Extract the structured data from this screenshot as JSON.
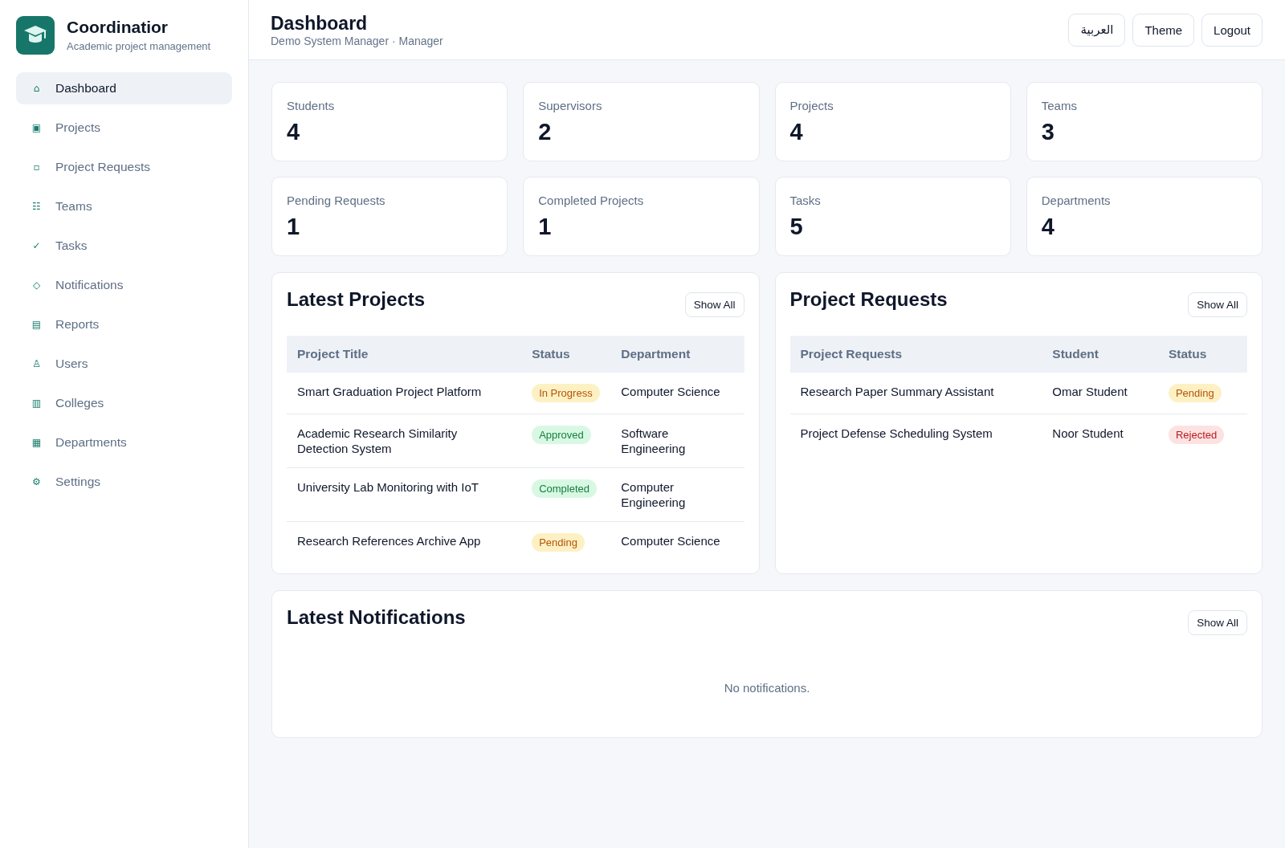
{
  "sidebar": {
    "brand": {
      "title": "Coordinatior",
      "subtitle": "Academic project management"
    },
    "items": [
      {
        "icon": "⌂",
        "label": "Dashboard",
        "selected": true
      },
      {
        "icon": "▣",
        "label": "Projects",
        "selected": false
      },
      {
        "icon": "▫",
        "label": "Project Requests",
        "selected": false
      },
      {
        "icon": "☷",
        "label": "Teams",
        "selected": false
      },
      {
        "icon": "✓",
        "label": "Tasks",
        "selected": false
      },
      {
        "icon": "◇",
        "label": "Notifications",
        "selected": false
      },
      {
        "icon": "▤",
        "label": "Reports",
        "selected": false
      },
      {
        "icon": "♙",
        "label": "Users",
        "selected": false
      },
      {
        "icon": "▥",
        "label": "Colleges",
        "selected": false
      },
      {
        "icon": "▦",
        "label": "Departments",
        "selected": false
      },
      {
        "icon": "⚙",
        "label": "Settings",
        "selected": false
      }
    ]
  },
  "header": {
    "title": "Dashboard",
    "subtitle": "Demo System Manager · Manager",
    "buttons": [
      "العربية",
      "Theme",
      "Logout"
    ]
  },
  "stats": [
    {
      "label": "Students",
      "value": "4"
    },
    {
      "label": "Supervisors",
      "value": "2"
    },
    {
      "label": "Projects",
      "value": "4"
    },
    {
      "label": "Teams",
      "value": "3"
    },
    {
      "label": "Pending Requests",
      "value": "1"
    },
    {
      "label": "Completed Projects",
      "value": "1"
    },
    {
      "label": "Tasks",
      "value": "5"
    },
    {
      "label": "Departments",
      "value": "4"
    }
  ],
  "latest_projects": {
    "title": "Latest Projects",
    "button": "Show All",
    "columns": [
      "Project Title",
      "Status",
      "Department"
    ],
    "rows": [
      [
        "Smart Graduation Project Platform",
        {
          "badge": "In Progress",
          "kind": "warning"
        },
        "Computer Science"
      ],
      [
        "Academic Research Similarity Detection System",
        {
          "badge": "Approved",
          "kind": "success"
        },
        "Software Engineering"
      ],
      [
        "University Lab Monitoring with IoT",
        {
          "badge": "Completed",
          "kind": "success"
        },
        "Computer Engineering"
      ],
      [
        "Research References Archive App",
        {
          "badge": "Pending",
          "kind": "warning"
        },
        "Computer Science"
      ]
    ]
  },
  "project_requests": {
    "title": "Project Requests",
    "button": "Show All",
    "columns": [
      "Project Requests",
      "Student",
      "Status"
    ],
    "rows": [
      [
        "Research Paper Summary Assistant",
        "Omar Student",
        {
          "badge": "Pending",
          "kind": "warning"
        }
      ],
      [
        "Project Defense Scheduling System",
        "Noor Student",
        {
          "badge": "Rejected",
          "kind": "danger"
        }
      ]
    ]
  },
  "latest_notifications": {
    "title": "Latest Notifications",
    "button": "Show All",
    "empty_message": "No notifications."
  }
}
